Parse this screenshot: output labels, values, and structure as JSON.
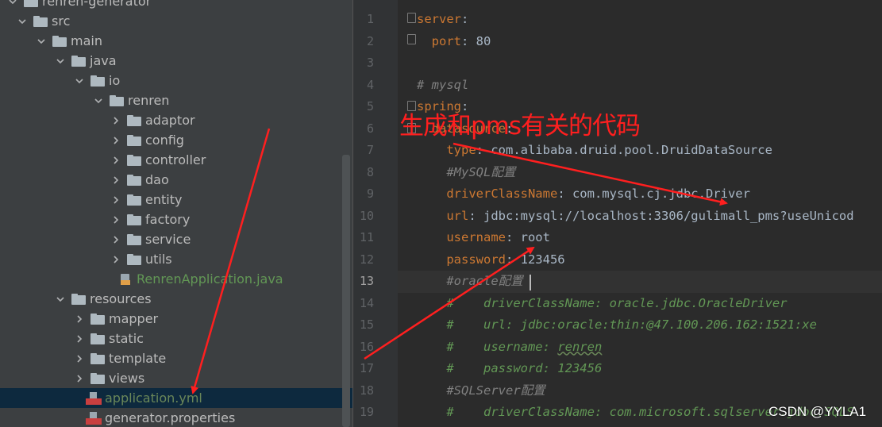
{
  "project_tree": {
    "items": [
      {
        "label": "renren-generator",
        "type": "folder",
        "expanded": true
      },
      {
        "label": "src",
        "type": "folder",
        "expanded": true
      },
      {
        "label": "main",
        "type": "folder",
        "expanded": true
      },
      {
        "label": "java",
        "type": "folder",
        "expanded": true
      },
      {
        "label": "io",
        "type": "folder",
        "expanded": true
      },
      {
        "label": "renren",
        "type": "folder",
        "expanded": true
      },
      {
        "label": "adaptor",
        "type": "folder",
        "expanded": false
      },
      {
        "label": "config",
        "type": "folder",
        "expanded": false
      },
      {
        "label": "controller",
        "type": "folder",
        "expanded": false
      },
      {
        "label": "dao",
        "type": "folder",
        "expanded": false
      },
      {
        "label": "entity",
        "type": "folder",
        "expanded": false
      },
      {
        "label": "factory",
        "type": "folder",
        "expanded": false
      },
      {
        "label": "service",
        "type": "folder",
        "expanded": false
      },
      {
        "label": "utils",
        "type": "folder",
        "expanded": false
      },
      {
        "label": "RenrenApplication.java",
        "type": "java"
      },
      {
        "label": "resources",
        "type": "folder",
        "expanded": true
      },
      {
        "label": "mapper",
        "type": "folder",
        "expanded": false
      },
      {
        "label": "static",
        "type": "folder",
        "expanded": false
      },
      {
        "label": "template",
        "type": "folder",
        "expanded": false
      },
      {
        "label": "views",
        "type": "folder",
        "expanded": false
      },
      {
        "label": "application.yml",
        "type": "yml",
        "selected": true
      },
      {
        "label": "generator.properties",
        "type": "properties"
      }
    ]
  },
  "editor": {
    "current_line": "13",
    "line_numbers": [
      "1",
      "2",
      "3",
      "4",
      "5",
      "6",
      "7",
      "8",
      "9",
      "10",
      "11",
      "12",
      "13",
      "14",
      "15",
      "16",
      "17",
      "18",
      "19"
    ],
    "lines": {
      "l1": {
        "k": "server",
        "r": ":"
      },
      "l2": {
        "k": "port",
        "r": ": 80"
      },
      "l4": {
        "c": "# mysql"
      },
      "l5": {
        "k": "spring",
        "r": ":"
      },
      "l6": {
        "k": "datasource",
        "r": ":"
      },
      "l7": {
        "k": "type",
        "r": ": com.alibaba.druid.pool.DruidDataSource"
      },
      "l8": {
        "c": "#MySQL配置"
      },
      "l9": {
        "k": "driverClassName",
        "r": ": com.mysql.cj.jdbc.Driver"
      },
      "l10": {
        "k": "url",
        "r": ": jdbc:mysql://localhost:3306/gulimall_pms?useUnicod"
      },
      "l11": {
        "k": "username",
        "r": ": root"
      },
      "l12": {
        "k": "password",
        "r": ": 123456"
      },
      "l13": {
        "c": "#oracle配置"
      },
      "l14": {
        "g": "#    driverClassName: oracle.jdbc.OracleDriver"
      },
      "l15": {
        "g": "#    url: jdbc:oracle:thin:@47.100.206.162:1521:xe"
      },
      "l16": {
        "g1": "#    username: ",
        "g2": "renren"
      },
      "l17": {
        "g": "#    password: 123456"
      },
      "l18": {
        "c": "#SQLServer配置"
      },
      "l19": {
        "g": "#    driverClassName: com.microsoft.sqlserver.jdbc.SQLS"
      }
    }
  },
  "annotation": {
    "text": "生成和pms有关的代码",
    "color": "#ff1f1f"
  },
  "watermark": {
    "text": "CSDN @YYLA1"
  },
  "colors": {
    "keyword": "#cc7832",
    "value": "#a9b7c6",
    "comment": "#808080",
    "comment_green": "#629755",
    "selection": "#0d293e",
    "arrow": "#ff1f1f"
  }
}
